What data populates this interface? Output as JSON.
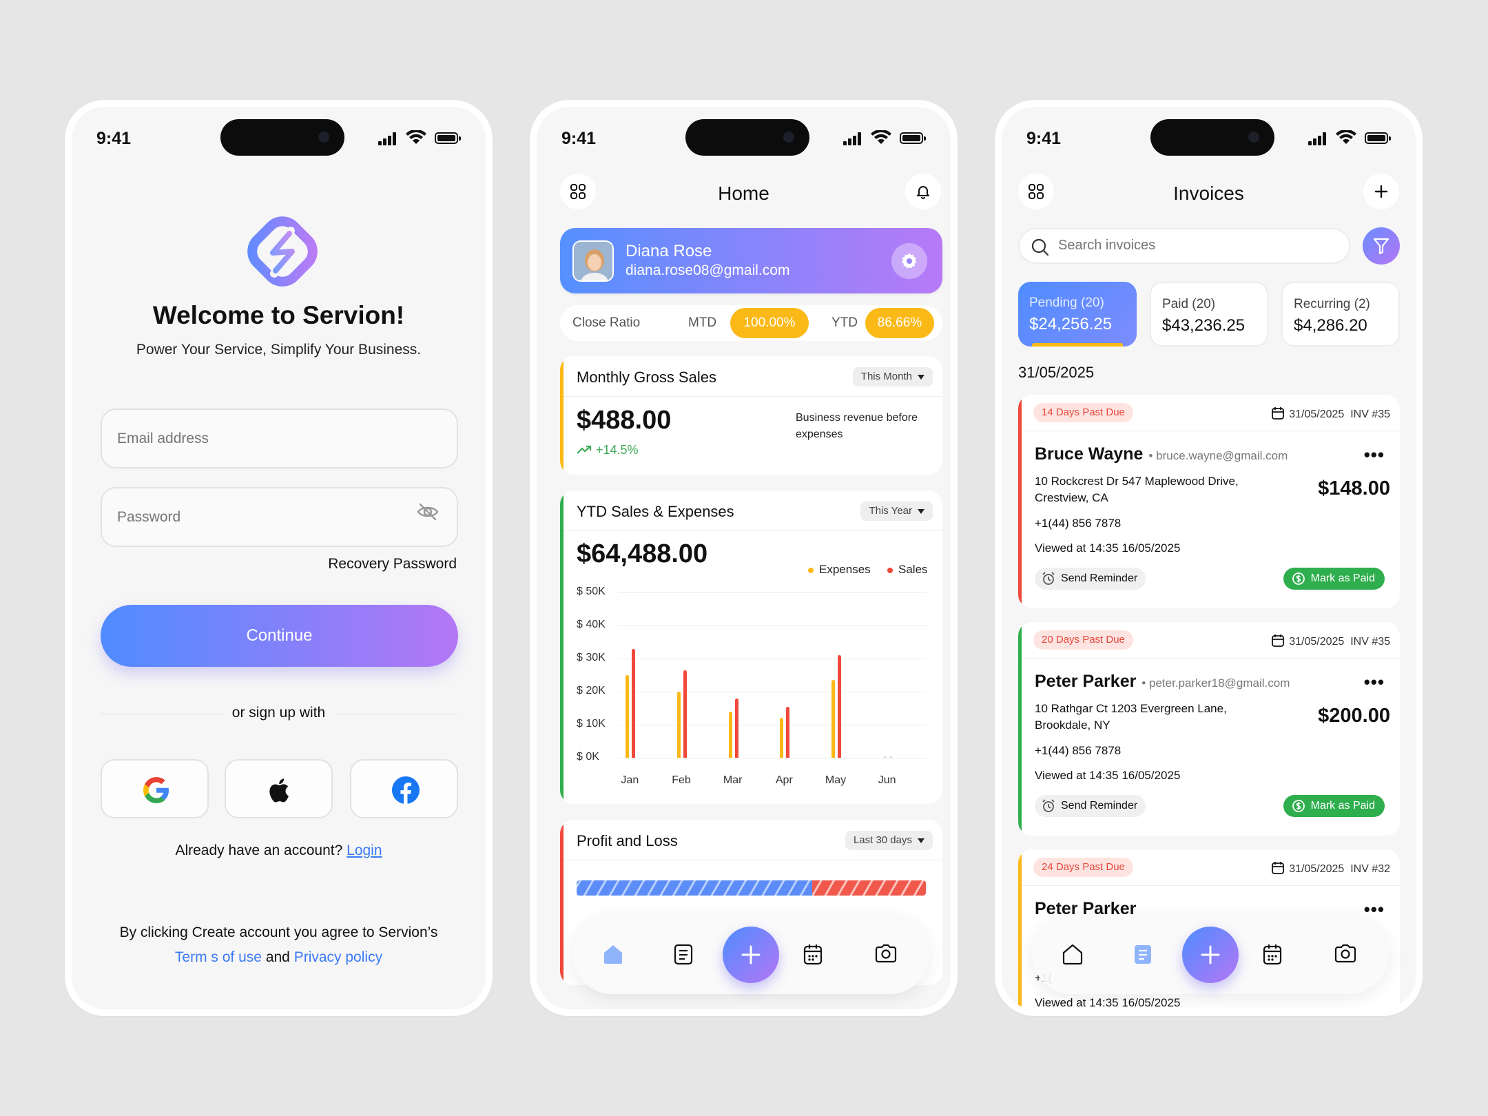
{
  "status": {
    "time": "9:41"
  },
  "login": {
    "title": "Welcome to Servion!",
    "tagline": "Power Your Service, Simplify Your Business.",
    "email_placeholder": "Email address",
    "password_placeholder": "Password",
    "recovery": "Recovery Password",
    "continue": "Continue",
    "or_signup": "or sign up with",
    "already": "Already have an account?",
    "login_link": "Login",
    "terms_prefix": "By clicking Create account you agree to Servion’s",
    "terms_link": "Term s of use",
    "and": "and",
    "privacy_link": "Privacy policy"
  },
  "home": {
    "title": "Home",
    "user": {
      "name": "Diana Rose",
      "email": "diana.rose08@gmail.com"
    },
    "close_ratio": {
      "label": "Close Ratio",
      "mtd_label": "MTD",
      "mtd_value": "100.00%",
      "ytd_label": "YTD",
      "ytd_value": "86.66%"
    },
    "monthly": {
      "title": "Monthly Gross Sales",
      "period": "This Month",
      "amount": "$488.00",
      "growth": "+14.5%",
      "description": "Business revenue before expenses"
    },
    "ytd": {
      "title": "YTD Sales & Expenses",
      "period": "This Year",
      "amount": "$64,488.00",
      "legend_expenses": "Expenses",
      "legend_sales": "Sales"
    },
    "profit": {
      "title": "Profit and Loss",
      "period": "Last 30 days",
      "profit_fraction": 0.675
    }
  },
  "chart_data": {
    "type": "bar",
    "categories": [
      "Jan",
      "Feb",
      "Mar",
      "Apr",
      "May",
      "Jun"
    ],
    "y_ticks": [
      "$ 50K",
      "$ 40K",
      "$ 30K",
      "$ 20K",
      "$ 10K",
      "$ 0K"
    ],
    "ylim": [
      0,
      50000
    ],
    "series": [
      {
        "name": "Expenses",
        "color": "#fbb917",
        "values": [
          25000,
          20000,
          14000,
          12000,
          23500,
          0
        ]
      },
      {
        "name": "Sales",
        "color": "#f0483a",
        "values": [
          33000,
          26500,
          18000,
          15500,
          31000,
          0
        ]
      }
    ],
    "legend": "top-right",
    "grid": true
  },
  "invoices": {
    "title": "Invoices",
    "search_placeholder": "Search invoices",
    "tabs": [
      {
        "label": "Pending (20)",
        "amount": "$24,256.25"
      },
      {
        "label": "Paid (20)",
        "amount": "$43,236.25"
      },
      {
        "label": "Recurring (2)",
        "amount": "$4,286.20"
      }
    ],
    "date_header": "31/05/2025",
    "items": [
      {
        "due": "14 Days Past Due",
        "date": "31/05/2025",
        "inv": "INV #35",
        "name": "Bruce Wayne",
        "email": "bruce.wayne@gmail.com",
        "address": "10 Rockcrest Dr 547 Maplewood Drive, Crestview, CA",
        "amount": "$148.00",
        "phone": "+1(44) 856 7878",
        "viewed": "Viewed at 14:35 16/05/2025",
        "remind": "Send Reminder",
        "paid": "Mark as Paid",
        "accent": "#f0483a"
      },
      {
        "due": "20 Days Past Due",
        "date": "31/05/2025",
        "inv": "INV #35",
        "name": "Peter Parker",
        "email": "peter.parker18@gmail.com",
        "address": "10 Rathgar Ct 1203 Evergreen Lane, Brookdale, NY",
        "amount": "$200.00",
        "phone": "+1(44) 856 7878",
        "viewed": "Viewed at 14:35 16/05/2025",
        "remind": "Send Reminder",
        "paid": "Mark as Paid",
        "accent": "#2fae4e"
      },
      {
        "due": "24 Days Past Due",
        "date": "31/05/2025",
        "inv": "INV #32",
        "name": "Peter Parker",
        "phone": "+1(",
        "viewed": "Viewed at 14:35 16/05/2025",
        "accent": "#fbb917"
      }
    ]
  }
}
